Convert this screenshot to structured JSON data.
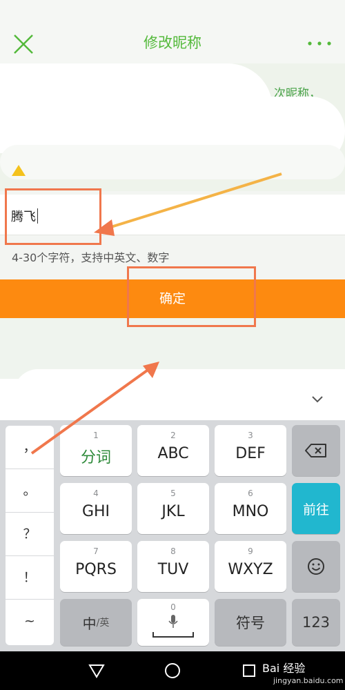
{
  "header": {
    "title": "修改昵称"
  },
  "notice": {
    "line1": "次昵称，"
  },
  "nickname": {
    "value": "腾飞"
  },
  "hint": "4-30个字符，支持中英文、数字",
  "confirm_label": "确定",
  "keyboard": {
    "punctuation": [
      "，",
      "。",
      "？",
      "！",
      "~"
    ],
    "keys": [
      {
        "num": "1",
        "label": "分词"
      },
      {
        "num": "2",
        "label": "ABC"
      },
      {
        "num": "3",
        "label": "DEF"
      },
      {
        "num": "4",
        "label": "GHI"
      },
      {
        "num": "5",
        "label": "JKL"
      },
      {
        "num": "6",
        "label": "MNO"
      },
      {
        "num": "7",
        "label": "PQRS"
      },
      {
        "num": "8",
        "label": "TUV"
      },
      {
        "num": "9",
        "label": "WXYZ"
      }
    ],
    "go_label": "前往",
    "zh_label": "中",
    "en_label": "/英",
    "space_num": "0",
    "symbol_label": "符号",
    "num_label": "123"
  },
  "watermark": {
    "brand": "Bai 经验",
    "url": "jingyan.baidu.com"
  },
  "colors": {
    "accent_green": "#53b93a",
    "confirm_orange": "#fd8a10",
    "go_key": "#21b7cf",
    "annotation": "#f0774c"
  }
}
